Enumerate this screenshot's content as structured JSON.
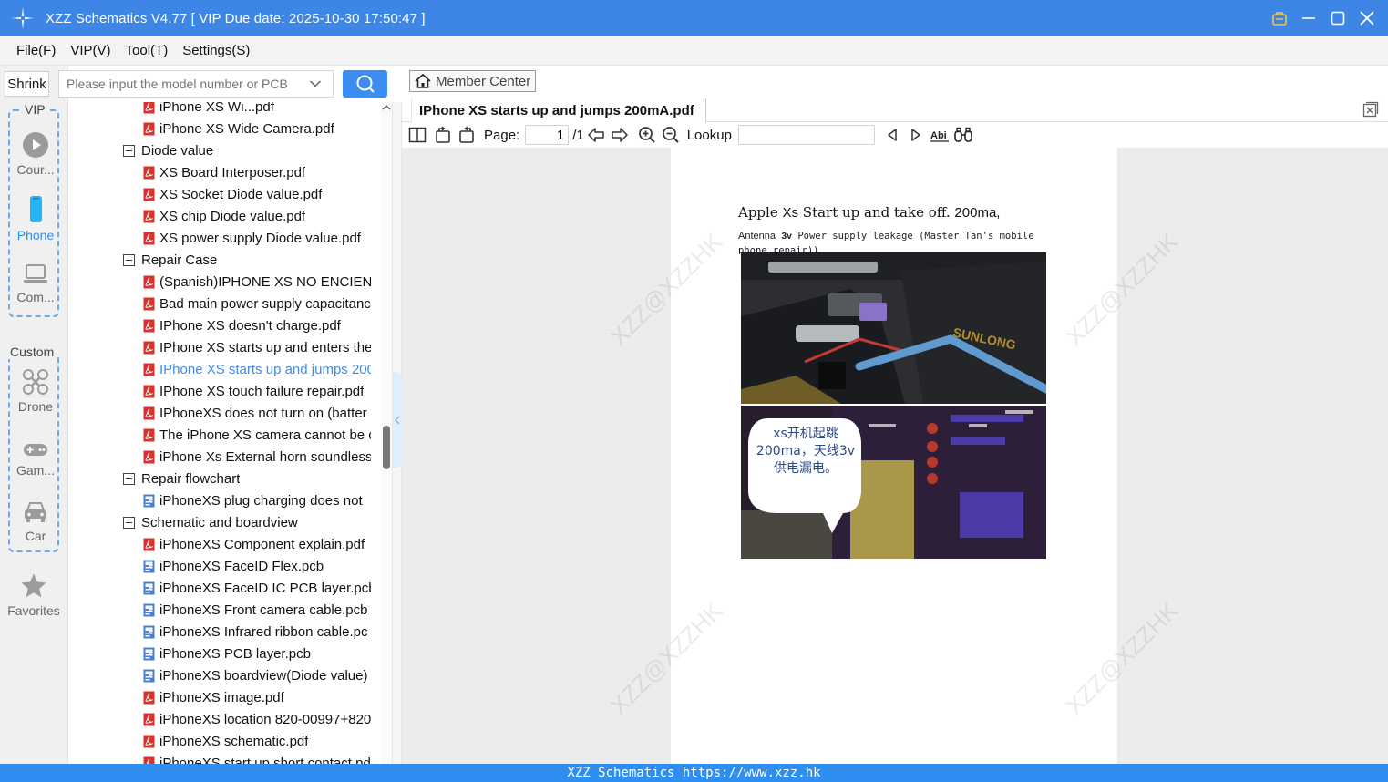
{
  "window": {
    "title": "XZZ Schematics V4.77 [ VIP Due date: 2025-10-30 17:50:47 ]"
  },
  "menu": [
    {
      "label": "File(F)"
    },
    {
      "label": "VIP(V)"
    },
    {
      "label": "Tool(T)"
    },
    {
      "label": "Settings(S)"
    }
  ],
  "rail": {
    "shrink": "Shrink",
    "vip_label": "VIP",
    "custom_label": "Custom",
    "items": {
      "course": "Cour...",
      "phone": "Phone",
      "computer": "Com...",
      "drone": "Drone",
      "game": "Gam...",
      "car": "Car",
      "favorites": "Favorites"
    }
  },
  "search": {
    "placeholder": "Please input the model number or PCB"
  },
  "tree": {
    "rows": [
      {
        "type": "pdf",
        "label": "iPhone XS Wi...pdf",
        "indent": 1
      },
      {
        "type": "pdf",
        "label": "iPhone XS Wide Camera.pdf",
        "indent": 1
      },
      {
        "type": "folder",
        "label": "Diode value",
        "indent": 0
      },
      {
        "type": "pdf",
        "label": "XS Board Interposer.pdf",
        "indent": 1
      },
      {
        "type": "pdf",
        "label": "XS Socket Diode value.pdf",
        "indent": 1
      },
      {
        "type": "pdf",
        "label": "XS chip Diode value.pdf",
        "indent": 1
      },
      {
        "type": "pdf",
        "label": "XS power supply Diode value.pdf",
        "indent": 1
      },
      {
        "type": "folder",
        "label": "Repair Case",
        "indent": 0
      },
      {
        "type": "pdf",
        "label": "(Spanish)IPHONE XS NO ENCIEND",
        "indent": 1
      },
      {
        "type": "pdf",
        "label": "Bad main power supply capacitanc",
        "indent": 1
      },
      {
        "type": "pdf",
        "label": "IPhone XS doesn't charge.pdf",
        "indent": 1
      },
      {
        "type": "pdf",
        "label": "IPhone XS starts up and enters the",
        "indent": 1
      },
      {
        "type": "pdf",
        "label": "IPhone XS starts up and jumps 200",
        "indent": 1,
        "selected": true
      },
      {
        "type": "pdf",
        "label": "IPhone XS touch failure repair.pdf",
        "indent": 1
      },
      {
        "type": "pdf",
        "label": "IPhoneXS does not turn on (batter",
        "indent": 1
      },
      {
        "type": "pdf",
        "label": "The iPhone XS camera cannot be c",
        "indent": 1
      },
      {
        "type": "pdf",
        "label": "iPhone Xs External horn soundless",
        "indent": 1
      },
      {
        "type": "folder",
        "label": "Repair flowchart",
        "indent": 0
      },
      {
        "type": "pcb",
        "label": "iPhoneXS plug charging does not",
        "indent": 1
      },
      {
        "type": "folder",
        "label": "Schematic and boardview",
        "indent": 0
      },
      {
        "type": "pdf",
        "label": "iPhoneXS Component explain.pdf",
        "indent": 1
      },
      {
        "type": "pcb",
        "label": "iPhoneXS FaceID Flex.pcb",
        "indent": 1
      },
      {
        "type": "pcb",
        "label": "iPhoneXS FaceID IC PCB layer.pcb",
        "indent": 1
      },
      {
        "type": "pcb",
        "label": "iPhoneXS Front camera cable.pcb",
        "indent": 1
      },
      {
        "type": "pcb",
        "label": "iPhoneXS Infrared ribbon cable.pc",
        "indent": 1
      },
      {
        "type": "pcb",
        "label": "iPhoneXS PCB layer.pcb",
        "indent": 1
      },
      {
        "type": "pcb",
        "label": "iPhoneXS boardview(Diode value)",
        "indent": 1
      },
      {
        "type": "pdf",
        "label": "iPhoneXS image.pdf",
        "indent": 1
      },
      {
        "type": "pdf",
        "label": "iPhoneXS location 820-00997+820",
        "indent": 1
      },
      {
        "type": "pdf",
        "label": "iPhoneXS schematic.pdf",
        "indent": 1
      },
      {
        "type": "pdf",
        "label": "iPhoneXS start up short contact.pd",
        "indent": 1
      }
    ]
  },
  "viewer": {
    "member_center": "Member Center",
    "doc_tab": "IPhone XS starts up and jumps 200mA.pdf",
    "page_label": "Page:",
    "page_value": "1",
    "page_total": "/1",
    "lookup_label": "Lookup",
    "doc": {
      "heading_a": "Apple",
      "heading_b": "Xs",
      "heading_c": "Start up and take off.",
      "heading_d": "200ma,",
      "subline_a": "Antenna",
      "subline_b": "3v",
      "subline_c": "Power supply leakage (Master Tan's mobile phone repair))",
      "bubble": "xs开机起跳200ma，天线3v供电漏电。",
      "photo_brand": "SUNLONG"
    },
    "watermark": "XZZ@XZZHK"
  },
  "status": {
    "text": "XZZ Schematics https://www.xzz.hk"
  },
  "colors": {
    "titlebar": "#3e86e6",
    "accent": "#2f8ff0",
    "pdf_icon": "#d9312b",
    "pcb_icon": "#4a7fd6"
  }
}
